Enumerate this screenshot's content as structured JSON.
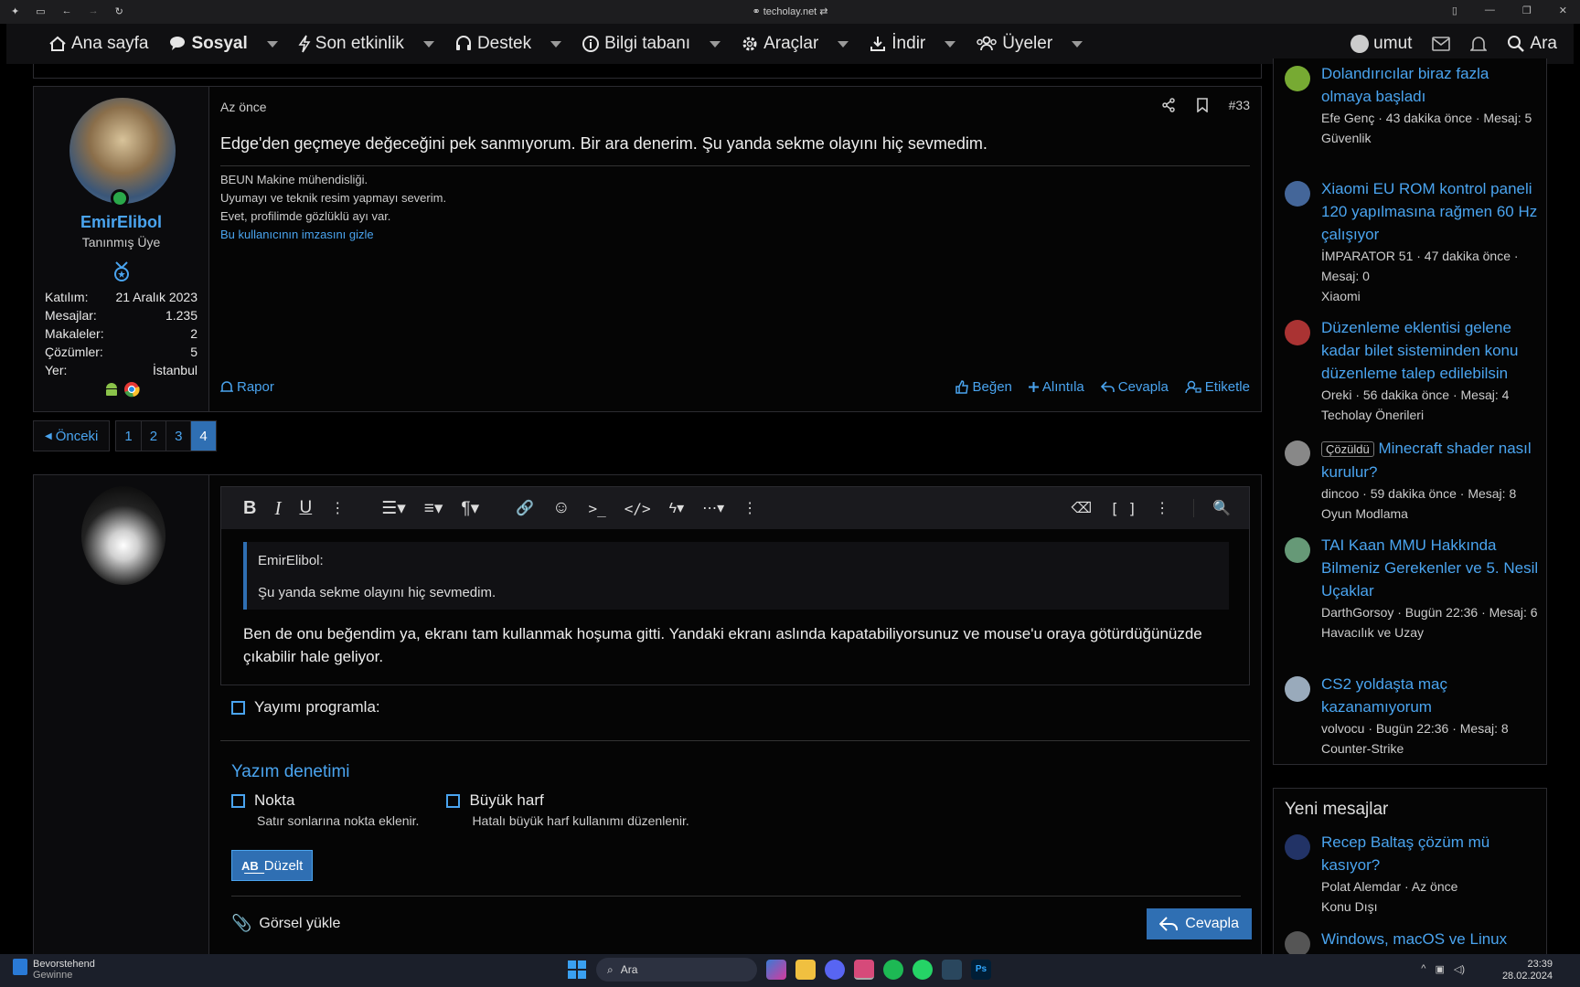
{
  "browser": {
    "url": "techolay.net"
  },
  "nav": {
    "items": [
      {
        "label": "Ana sayfa"
      },
      {
        "label": "Sosyal"
      },
      {
        "label": "Son etkinlik"
      },
      {
        "label": "Destek"
      },
      {
        "label": "Bilgi tabanı"
      },
      {
        "label": "Araçlar"
      },
      {
        "label": "İndir"
      },
      {
        "label": "Üyeler"
      }
    ],
    "user": "umut",
    "search": "Ara"
  },
  "post": {
    "time": "Az önce",
    "number": "#33",
    "author": "EmirElibol",
    "role": "Tanınmış Üye",
    "stats": [
      {
        "k": "Katılım:",
        "v": "21 Aralık 2023"
      },
      {
        "k": "Mesajlar:",
        "v": "1.235"
      },
      {
        "k": "Makaleler:",
        "v": "2"
      },
      {
        "k": "Çözümler:",
        "v": "5"
      },
      {
        "k": "Yer:",
        "v": "İstanbul"
      }
    ],
    "body": "Edge'den geçmeye değeceğini pek sanmıyorum. Bir ara denerim. Şu yanda sekme olayını hiç sevmedim.",
    "signature": [
      "BEUN Makine mühendisliği.",
      "Uyumayı ve teknik resim yapmayı severim.",
      "Evet, profilimde gözlüklü ayı var."
    ],
    "hide_sig": "Bu kullanıcının imzasını gizle",
    "report": "Rapor",
    "actions": {
      "like": "Beğen",
      "quote": "Alıntıla",
      "reply": "Cevapla",
      "tag": "Etiketle"
    }
  },
  "pager": {
    "prev": "Önceki",
    "pages": [
      "1",
      "2",
      "3",
      "4"
    ],
    "current": "4"
  },
  "editor": {
    "quote_author": "EmirElibol:",
    "quote_text": "Şu yanda sekme olayını hiç sevmedim.",
    "typed": "Ben de onu beğendim ya, ekranı tam kullanmak hoşuma gitti. Yandaki ekranı aslında kapatabiliyorsunuz ve mouse'u oraya götürdüğünüzde çıkabilir hale geliyor.",
    "schedule": "Yayımı programla:",
    "spell_title": "Yazım denetimi",
    "opt1": {
      "label": "Nokta",
      "desc": "Satır sonlarına nokta eklenir."
    },
    "opt2": {
      "label": "Büyük harf",
      "desc": "Hatalı büyük harf kullanımı düzenlenir."
    },
    "fix": "Düzelt",
    "upload": "Görsel yükle",
    "send": "Cevapla"
  },
  "sidebar": {
    "threads": [
      {
        "title": "Dolandırıcılar biraz fazla olmaya başladı",
        "meta": "Efe Genç · 43 dakika önce · Mesaj: 5",
        "forum": "Güvenlik"
      },
      {
        "title": "Xiaomi EU ROM kontrol paneli 120 yapılmasına rağmen 60 Hz çalışıyor",
        "meta": "İMPARATOR 51 · 47 dakika önce · Mesaj: 0",
        "forum": "Xiaomi"
      },
      {
        "title": "Düzenleme eklentisi gelene kadar bilet sisteminden konu düzenleme talep edilebilsin",
        "meta": "Oreki · 56 dakika önce · Mesaj: 4",
        "forum": "Techolay Önerileri"
      },
      {
        "tag": "Çözüldü",
        "title": "Minecraft shader nasıl kurulur?",
        "meta": "dincoo · 59 dakika önce · Mesaj: 8",
        "forum": "Oyun Modlama"
      },
      {
        "title": "TAI Kaan MMU Hakkında Bilmeniz Gerekenler ve 5. Nesil Uçaklar",
        "meta": "DarthGorsoy · Bugün 22:36 · Mesaj: 6",
        "forum": "Havacılık ve Uzay"
      },
      {
        "title": "CS2 yoldaşta maç kazanamıyorum",
        "meta": "volvocu · Bugün 22:36 · Mesaj: 8",
        "forum": "Counter-Strike"
      }
    ],
    "new_title": "Yeni mesajlar",
    "new": [
      {
        "title": "Recep Baltaş çözüm mü kasıyor?",
        "meta": "Polat Alemdar · Az önce",
        "forum": "Konu Dışı"
      },
      {
        "title": "Windows, macOS ve Linux"
      }
    ]
  },
  "taskbar": {
    "widget1": "Bevorstehend",
    "widget2": "Gewinne",
    "search": "Ara",
    "time": "23:39",
    "date": "28.02.2024"
  },
  "colors": {
    "accent": "#4aa4ef",
    "button": "#2f6fb3",
    "online": "#2aa84a"
  }
}
